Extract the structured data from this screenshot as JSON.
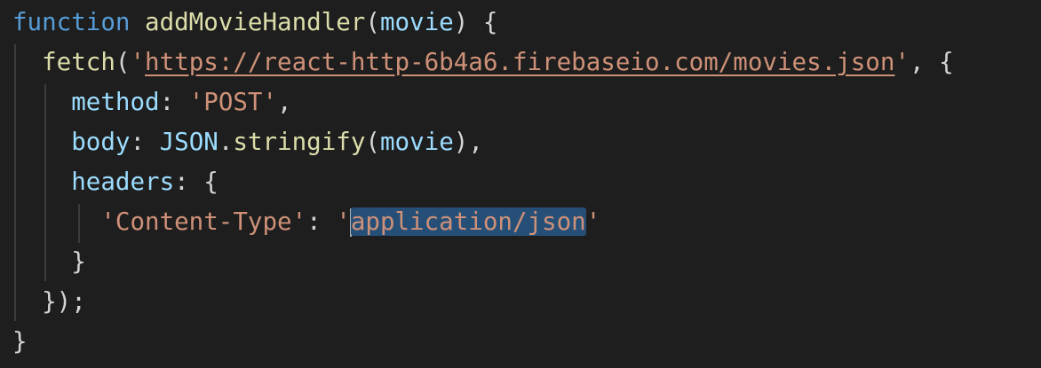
{
  "code": {
    "line1": {
      "keyword": "function",
      "name": "addMovieHandler",
      "open": "(",
      "param": "movie",
      "close": ") {"
    },
    "line2": {
      "fn": "fetch",
      "open": "(",
      "q1": "'",
      "url": "https://react-http-6b4a6.firebaseio.com/movies.json",
      "q2": "'",
      "rest": ", {"
    },
    "line3": {
      "key": "method",
      "colon": ": ",
      "value": "'POST'",
      "comma": ","
    },
    "line4": {
      "key": "body",
      "colon": ": ",
      "obj": "JSON",
      "dot": ".",
      "fn": "stringify",
      "open": "(",
      "arg": "movie",
      "close": "),"
    },
    "line5": {
      "key": "headers",
      "rest": ": {"
    },
    "line6": {
      "key": "'Content-Type'",
      "colon": ": ",
      "q1": "'",
      "selected": "application/json",
      "q2": "'"
    },
    "line7": {
      "text": "}"
    },
    "line8": {
      "text": "});"
    },
    "line9": {
      "text": "}"
    }
  },
  "colors": {
    "background": "#1e1e1e",
    "keyword": "#569cd6",
    "function": "#dcdcaa",
    "variable": "#9cdcfe",
    "string": "#ce9178",
    "selection": "#264f78"
  }
}
